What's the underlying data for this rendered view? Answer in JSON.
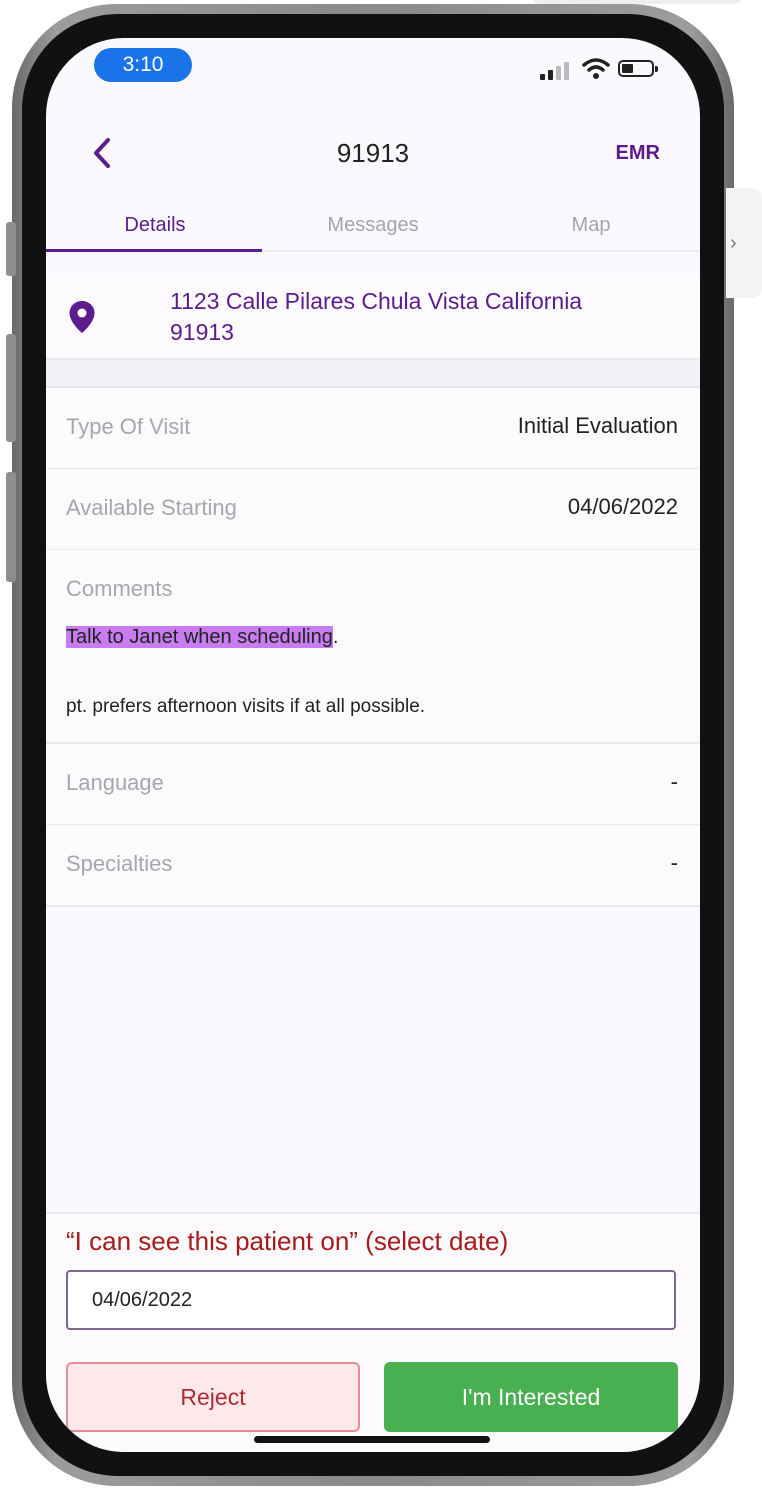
{
  "status_bar": {
    "time": "3:10"
  },
  "header": {
    "title": "91913",
    "emr_label": "EMR"
  },
  "tabs": [
    {
      "label": "Details",
      "active": true
    },
    {
      "label": "Messages",
      "active": false
    },
    {
      "label": "Map",
      "active": false
    }
  ],
  "address": {
    "line1": "1123 Calle Pilares Chula Vista California",
    "line2": "91913"
  },
  "details": {
    "type_of_visit": {
      "label": "Type Of Visit",
      "value": "Initial Evaluation"
    },
    "available_starting": {
      "label": "Available Starting",
      "value": "04/06/2022"
    },
    "comments": {
      "label": "Comments",
      "highlighted_text": "Talk to Janet when scheduling",
      "highlight_suffix": ".",
      "line2": "pt. prefers afternoon visits if at all possible."
    },
    "language": {
      "label": "Language",
      "value": "-"
    },
    "specialties": {
      "label": "Specialties",
      "value": "-"
    }
  },
  "scheduling": {
    "prompt": "“I can see this patient on” (select date)",
    "date_value": "04/06/2022"
  },
  "actions": {
    "reject_label": "Reject",
    "interested_label": "I'm Interested"
  },
  "colors": {
    "accent": "#5c1c8c",
    "highlight": "#c77df0",
    "prompt_red": "#a61b1b",
    "reject_bg": "#fde8ea",
    "interested_green": "#48b050",
    "time_pill_blue": "#1a73e8"
  },
  "icons": [
    "back-chevron-icon",
    "location-pin-icon",
    "signal-icon",
    "wifi-icon",
    "battery-icon",
    "side-chevron-icon"
  ]
}
